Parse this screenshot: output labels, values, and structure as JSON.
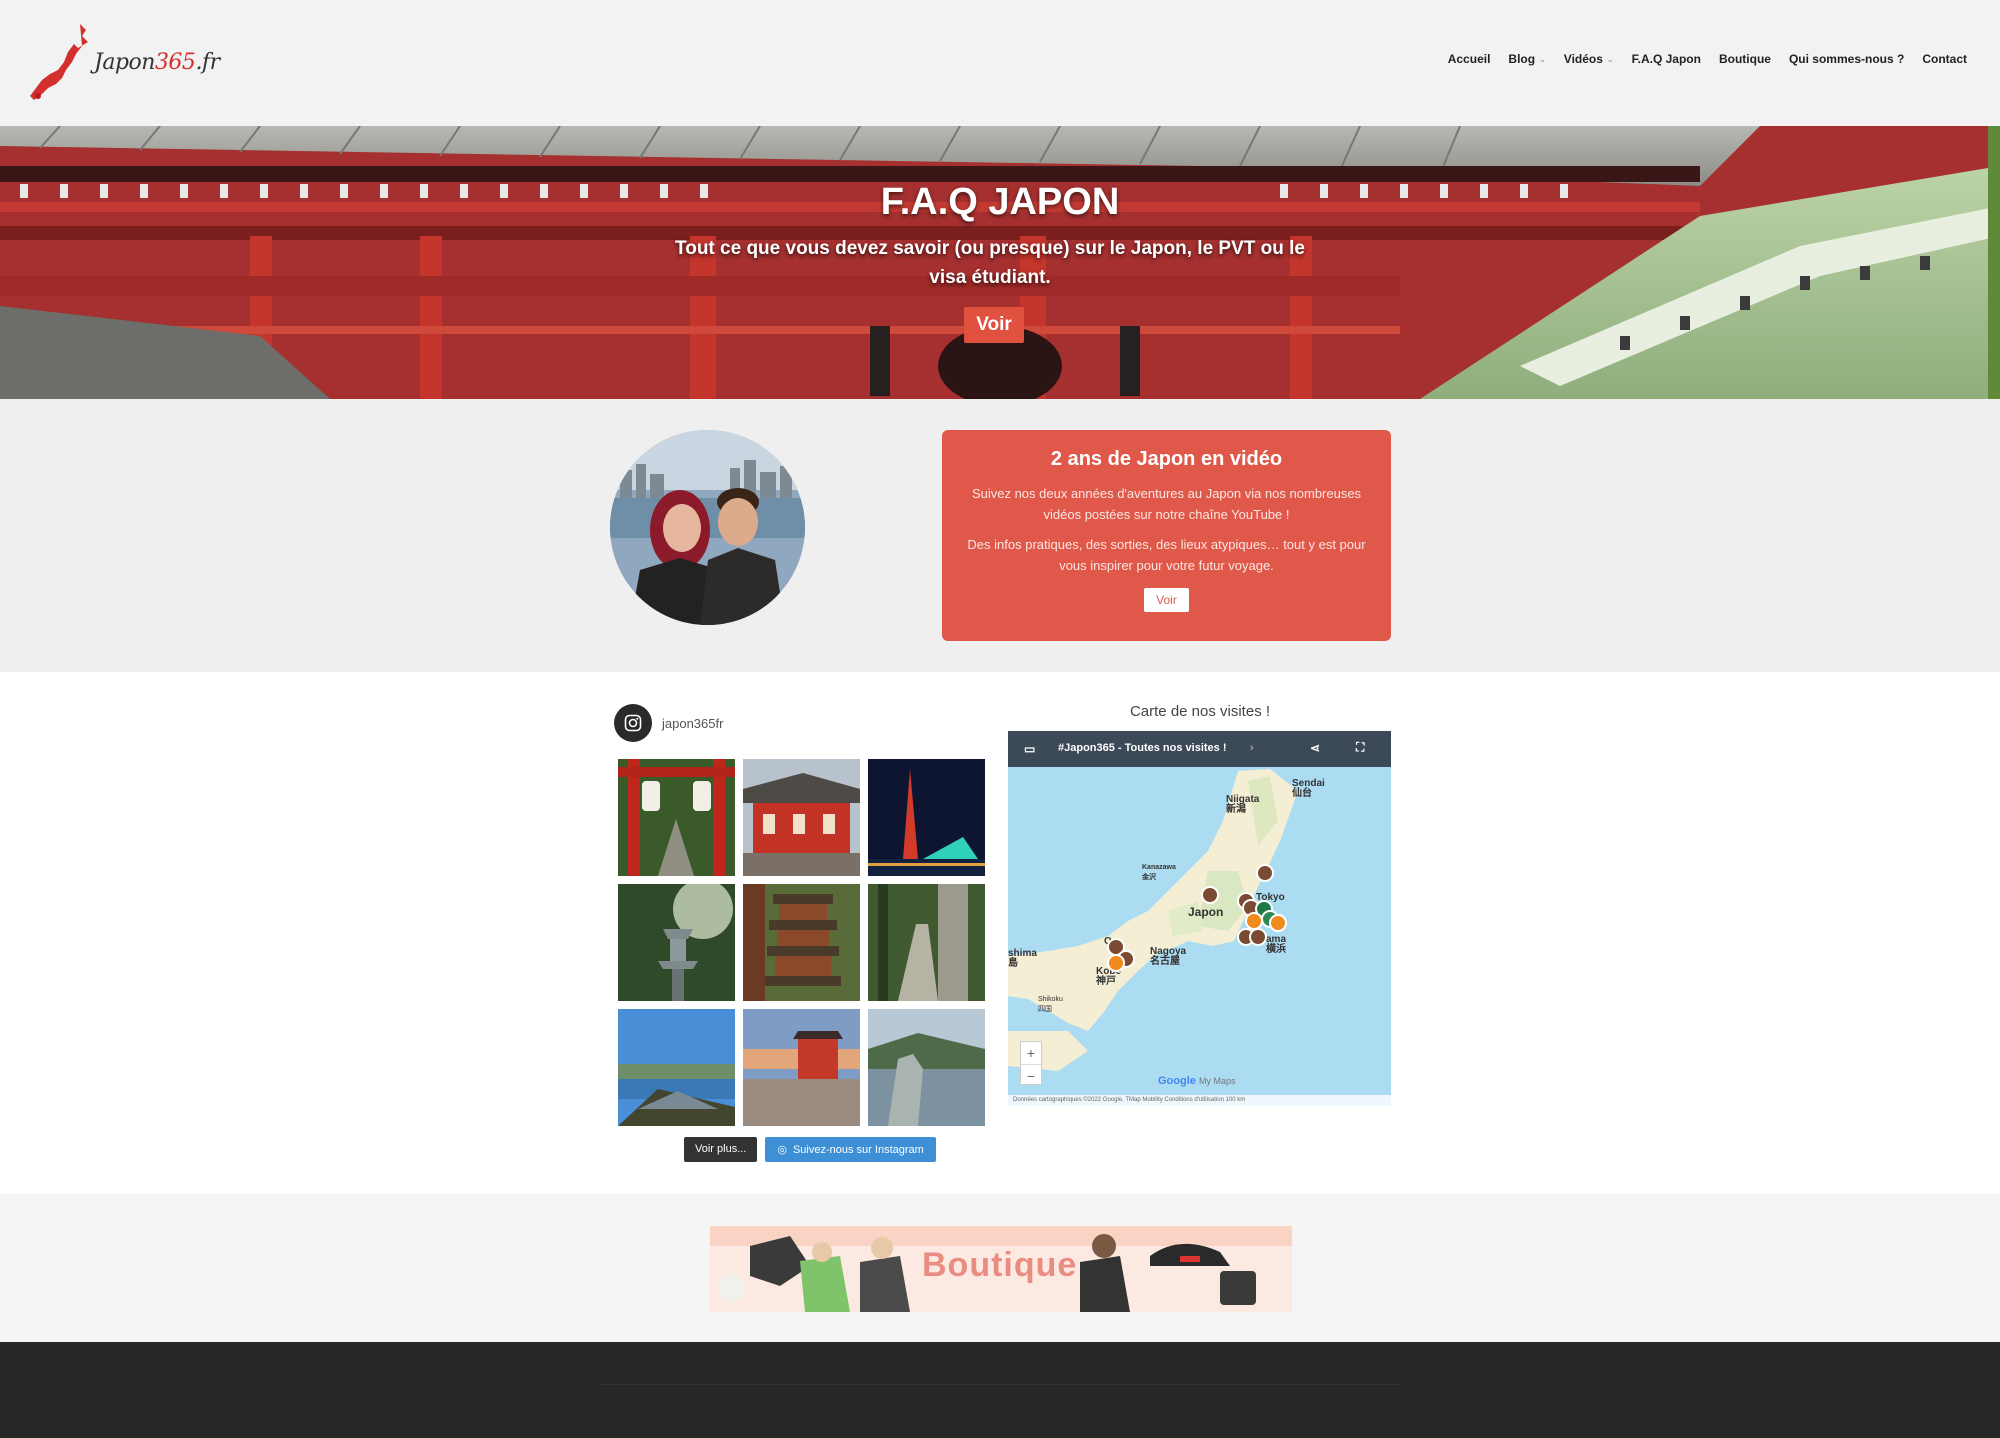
{
  "header": {
    "logo_text": "Japon",
    "logo_num": "365",
    "logo_tld": ".fr",
    "nav": [
      {
        "label": "Accueil",
        "dropdown": false
      },
      {
        "label": "Blog",
        "dropdown": true
      },
      {
        "label": "Vidéos",
        "dropdown": true
      },
      {
        "label": "F.A.Q Japon",
        "dropdown": false
      },
      {
        "label": "Boutique",
        "dropdown": false
      },
      {
        "label": "Qui sommes-nous ?",
        "dropdown": false
      },
      {
        "label": "Contact",
        "dropdown": false
      }
    ]
  },
  "hero": {
    "title": "F.A.Q JAPON",
    "subtitle": "Tout ce que vous devez savoir (ou presque) sur le Japon, le PVT ou le visa étudiant.",
    "button": "Voir"
  },
  "video_card": {
    "title": "2 ans de Japon en vidéo",
    "text1": "Suivez nos deux années d'aventures au Japon via nos nombreuses vidéos postées sur notre chaîne YouTube !",
    "text2": "Des infos pratiques, des sorties, des lieux atypiques… tout y est pour vous inspirer pour votre futur voyage.",
    "button": "Voir"
  },
  "instagram": {
    "username": "japon365fr",
    "more_button": "Voir plus...",
    "follow_button": "Suivez-nous sur Instagram"
  },
  "map": {
    "heading": "Carte de nos visites !",
    "bar_title": "#Japon365 - Toutes nos visites !",
    "labels": {
      "sendai": "Sendai",
      "sendai_jp": "仙台",
      "niigata": "Niigata",
      "niigata_jp": "新潟",
      "kanazawa": "Kanazawa",
      "kanazawa_jp": "金沢",
      "japon": "Japon",
      "tokyo": "Tokyo",
      "yokohama": "ama",
      "yokohama_jp": "横浜",
      "nagoya": "Nagoya",
      "nagoya_jp": "名古屋",
      "osaka": "Os",
      "kobe": "Kobe",
      "kobe_jp": "神戸",
      "hiroshima": "shima",
      "hiroshima_jp": "島",
      "shikoku": "Shikoku",
      "shikoku_jp": "四国"
    },
    "zoom_in": "+",
    "zoom_out": "−",
    "google": "Google",
    "mymaps": "My Maps",
    "attribution": "Données cartographiques ©2022 Google, TMap Mobility    Conditions d'utilisation    100 km"
  },
  "shop": {
    "banner_text": "Boutique"
  },
  "colors": {
    "accent": "#e0584a",
    "brand_red": "#d32f2f",
    "insta_blue": "#3d8fd6"
  }
}
